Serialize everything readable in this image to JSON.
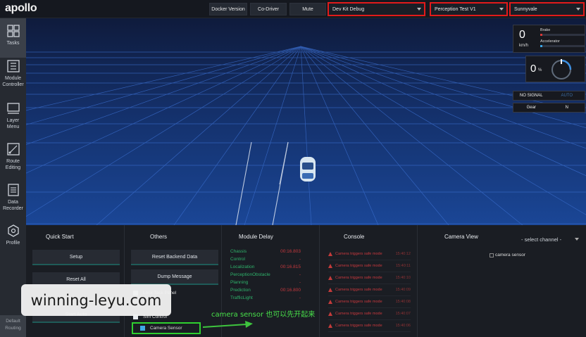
{
  "app": {
    "logo": "apollo"
  },
  "topbar": {
    "docker_version": "Docker Version",
    "co_driver": "Co-Driver",
    "mute": "Mute",
    "mode_select": "Dev Kit Debug",
    "vehicle_select": "Perception Test V1",
    "map_select": "Sunnyvale"
  },
  "sidebar": {
    "items": [
      {
        "label": "Tasks",
        "icon": "grid-icon"
      },
      {
        "label": "Module\nController",
        "icon": "sliders-icon"
      },
      {
        "label": "Layer\nMenu",
        "icon": "layers-icon"
      },
      {
        "label": "Route\nEditing",
        "icon": "route-icon"
      },
      {
        "label": "Data\nRecorder",
        "icon": "document-icon"
      },
      {
        "label": "Profile",
        "icon": "hexagon-icon"
      }
    ],
    "bottom_label": "Default\nRouting"
  },
  "dashboard": {
    "speed": "0",
    "speed_unit": "km/h",
    "brake_label": "Brake",
    "accelerator_label": "Accelerator",
    "steering": "0",
    "steering_unit": "%",
    "signal": "NO SIGNAL",
    "auto_label": "AUTO",
    "gear_label": "Gear",
    "gear_value": "N"
  },
  "quick_start": {
    "title": "Quick Start",
    "setup": "Setup",
    "reset_all": "Reset All",
    "start_auto": "Start Auto"
  },
  "others": {
    "title": "Others",
    "reset_backend": "Reset Backend Data",
    "dump_message": "Dump Message",
    "lock_task_panel": "Lock Task Panel",
    "sim_control": "Sim Control",
    "camera_sensor": "Camera Sensor"
  },
  "module_delay": {
    "title": "Module Delay",
    "rows": [
      {
        "name": "Chassis",
        "value": "00:16.803"
      },
      {
        "name": "Control",
        "value": "-"
      },
      {
        "name": "Localization",
        "value": "00:16.815"
      },
      {
        "name": "PerceptionObstacle",
        "value": "-"
      },
      {
        "name": "Planning",
        "value": "-"
      },
      {
        "name": "Prediction",
        "value": "00:16.800"
      },
      {
        "name": "TrafficLight",
        "value": "-"
      }
    ]
  },
  "console": {
    "title": "Console",
    "rows": [
      {
        "msg": "Camera triggers safe mode",
        "time": "15:40:12"
      },
      {
        "msg": "Camera triggers safe mode",
        "time": "15:40:11"
      },
      {
        "msg": "Camera triggers safe mode",
        "time": "15:40:10"
      },
      {
        "msg": "Camera triggers safe mode",
        "time": "15:40:09"
      },
      {
        "msg": "Camera triggers safe mode",
        "time": "15:40:08"
      },
      {
        "msg": "Camera triggers safe mode",
        "time": "15:40:07"
      },
      {
        "msg": "Camera triggers safe mode",
        "time": "15:40:06"
      }
    ]
  },
  "camera_view": {
    "title": "Camera View",
    "channel_placeholder": "- select channel -",
    "image_alt": "camera sensor"
  },
  "overlay": {
    "watermark": "winning-leyu.com",
    "annotation": "camera sensor 也可以先开起来"
  }
}
